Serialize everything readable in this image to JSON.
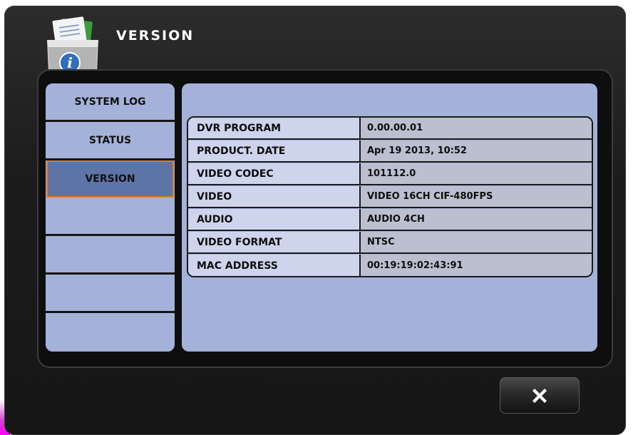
{
  "window": {
    "title": "VERSION",
    "icon": "info-folder-icon"
  },
  "sidebar": {
    "items": [
      {
        "label": "SYSTEM LOG",
        "active": false
      },
      {
        "label": "STATUS",
        "active": false
      },
      {
        "label": "VERSION",
        "active": true
      },
      {
        "label": "",
        "active": false
      },
      {
        "label": "",
        "active": false
      },
      {
        "label": "",
        "active": false
      },
      {
        "label": "",
        "active": false
      }
    ]
  },
  "version_table": {
    "rows": [
      {
        "label": "DVR PROGRAM",
        "value": "0.00.00.01"
      },
      {
        "label": "PRODUCT. DATE",
        "value": "Apr 19 2013, 10:52"
      },
      {
        "label": "VIDEO CODEC",
        "value": "101112.0"
      },
      {
        "label": "VIDEO",
        "value": "VIDEO 16CH CIF-480FPS"
      },
      {
        "label": "AUDIO",
        "value": "AUDIO 4CH"
      },
      {
        "label": "VIDEO FORMAT",
        "value": "NTSC"
      },
      {
        "label": "MAC ADDRESS",
        "value": "00:19:19:02:43:91"
      }
    ]
  },
  "footer": {
    "close_icon": "close-x-icon"
  },
  "colors": {
    "panel": "#a4b1d8",
    "active_item": "#5f74a6",
    "active_border": "#e07a24",
    "label_cell": "#cdd4ec",
    "value_cell": "#bcbfd0"
  }
}
